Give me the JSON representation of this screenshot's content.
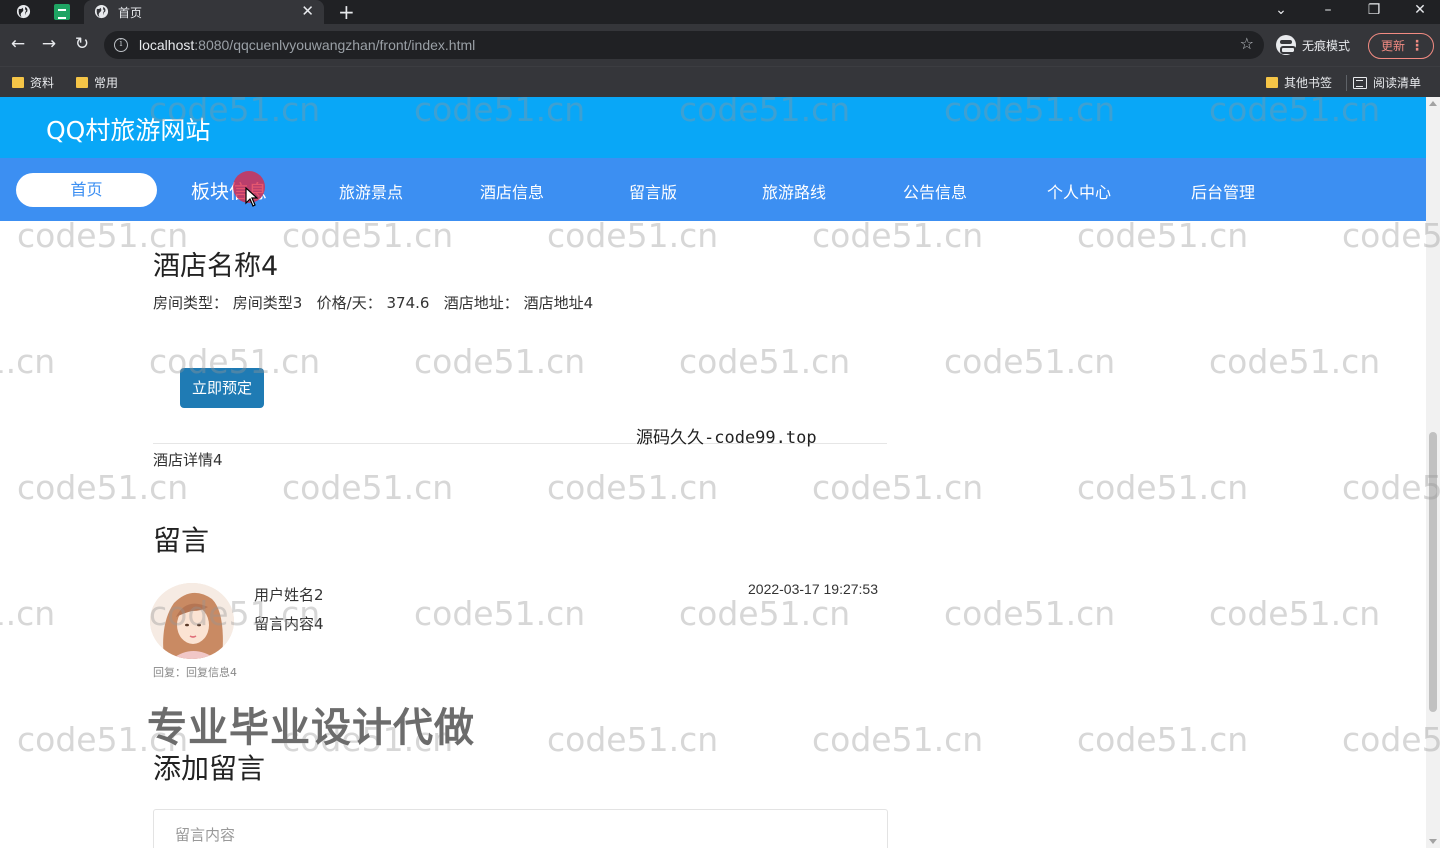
{
  "browser": {
    "tab_title": "首页",
    "url_host": "localhost",
    "url_rest": ":8080/qqcuenlvyouwangzhan/front/index.html",
    "incognito_label": "无痕模式",
    "update_label": "更新",
    "bookmarks": [
      "资料",
      "常用"
    ],
    "bookmarks_right": [
      "其他书签",
      "阅读清单"
    ]
  },
  "site": {
    "title": "QQ村旅游网站",
    "nav": [
      "首页",
      "板块信息",
      "旅游景点",
      "酒店信息",
      "留言版",
      "旅游路线",
      "公告信息",
      "个人中心",
      "后台管理"
    ]
  },
  "hotel": {
    "name": "酒店名称4",
    "room_type_label": "房间类型：",
    "room_type": "房间类型3",
    "price_label": "价格/天：",
    "price": "374.6",
    "address_label": "酒店地址：",
    "address": "酒店地址4",
    "book_button": "立即预定",
    "detail": "酒店详情4"
  },
  "comments": {
    "section_title": "留言",
    "items": [
      {
        "user": "用户姓名2",
        "content": "留言内容4",
        "time": "2022-03-17 19:27:53",
        "reply": "回复：回复信息4"
      }
    ]
  },
  "add_comment": {
    "title": "添加留言",
    "placeholder": "留言内容"
  },
  "overlays": {
    "watermark": "code51.cn",
    "promo": "专业毕业设计代做",
    "source": "源码久久-code99.top"
  },
  "colors": {
    "header": "#09a7f7",
    "navbar": "#3c8ff2",
    "book_button": "#1f7bb4"
  }
}
